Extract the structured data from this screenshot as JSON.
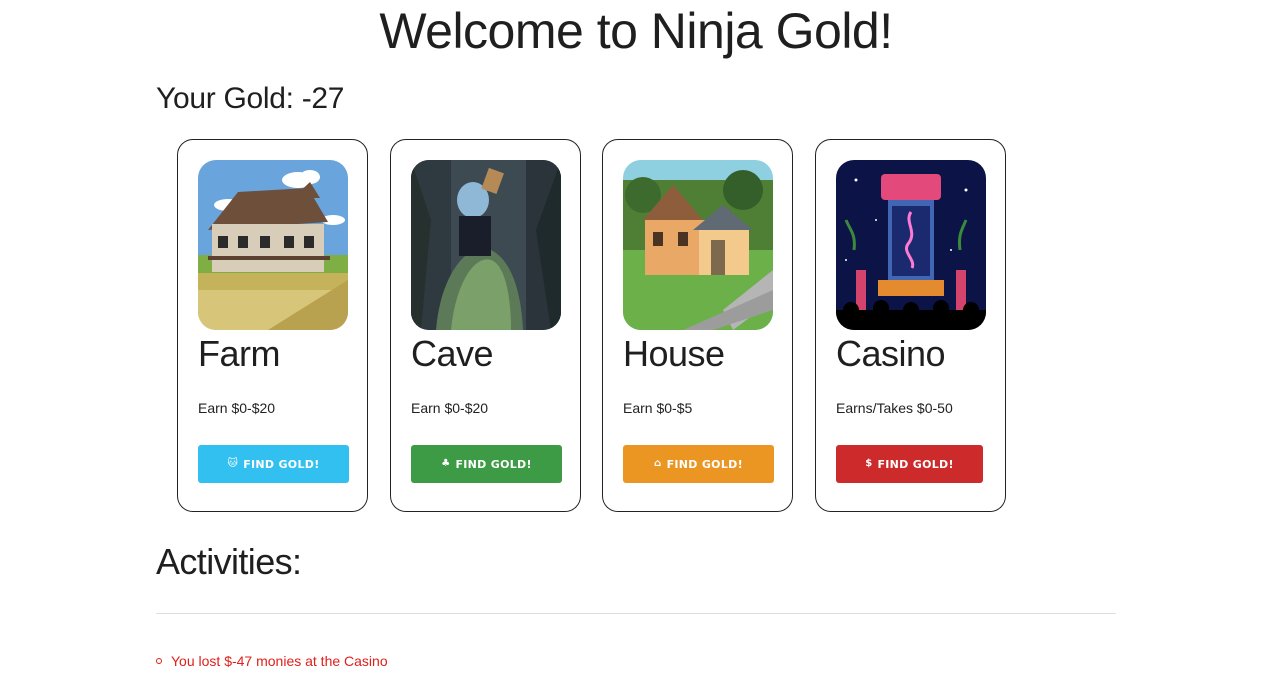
{
  "header": {
    "title": "Welcome to Ninja Gold!",
    "gold_label": "Your Gold: -27"
  },
  "cards": [
    {
      "name": "Farm",
      "desc": "Earn $0-$20",
      "button_label": "FIND GOLD!",
      "button_icon": "paw-icon",
      "button_glyph": "🐱",
      "button_color": "#31c0ef"
    },
    {
      "name": "Cave",
      "desc": "Earn $0-$20",
      "button_label": "FIND GOLD!",
      "button_icon": "tree-icon",
      "button_glyph": "♣",
      "button_color": "#3e9b45"
    },
    {
      "name": "House",
      "desc": "Earn $0-$5",
      "button_label": "FIND GOLD!",
      "button_icon": "home-icon",
      "button_glyph": "⌂",
      "button_color": "#eb9622"
    },
    {
      "name": "Casino",
      "desc": "Earns/Takes $0-50",
      "button_label": "FIND GOLD!",
      "button_icon": "dollar-icon",
      "button_glyph": "$",
      "button_color": "#cc2a2b"
    }
  ],
  "activities": {
    "title": "Activities:",
    "items": [
      {
        "text": "You lost $-47 monies at the Casino",
        "color": "#e0201b"
      }
    ]
  }
}
